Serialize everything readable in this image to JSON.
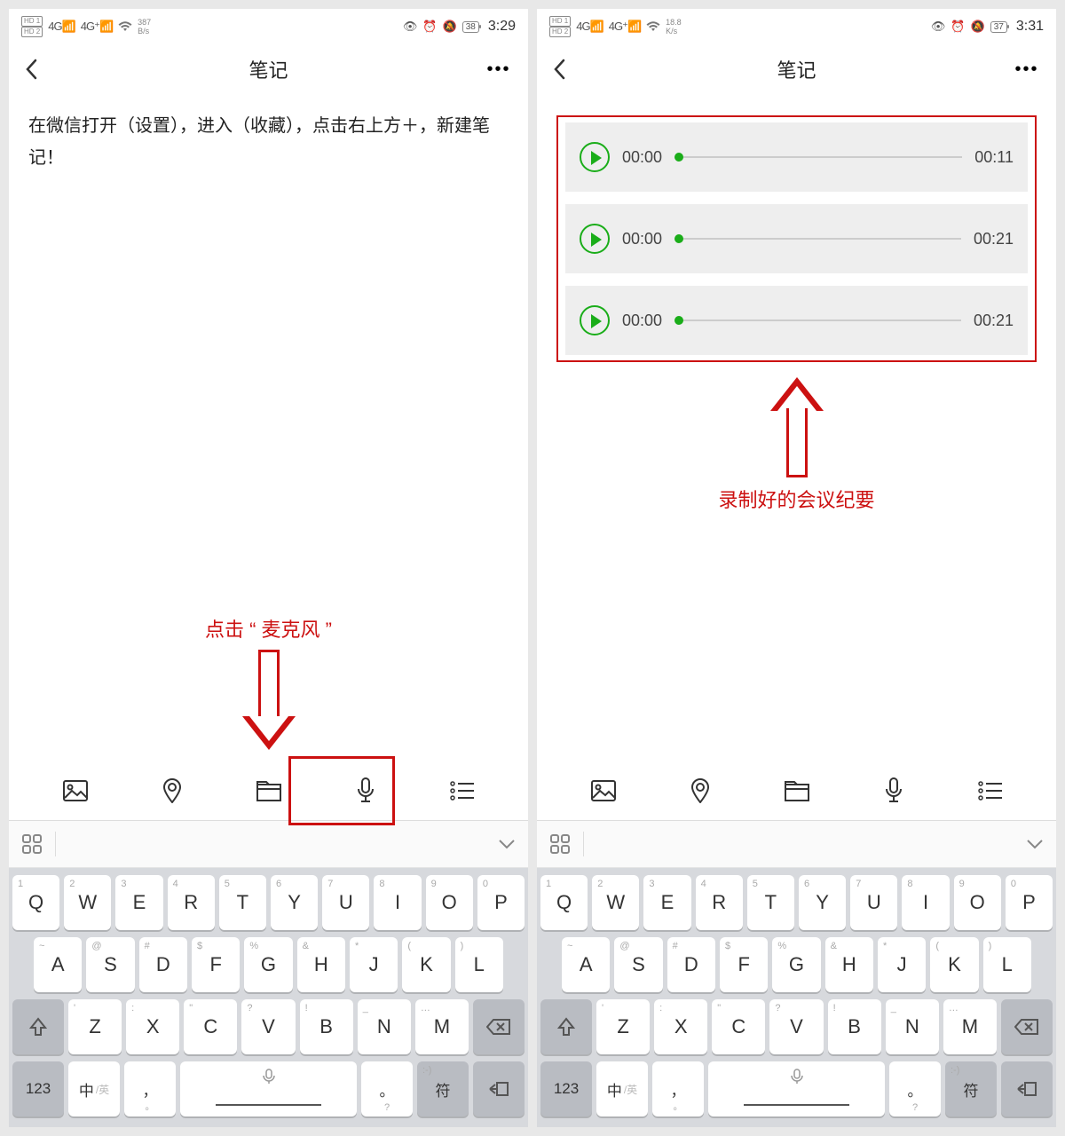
{
  "left": {
    "status": {
      "speed": "387",
      "speed_unit": "B/s",
      "battery": "38",
      "time": "3:29",
      "hd1": "HD 1",
      "hd2": "HD 2",
      "net1": "4G",
      "net2": "4G⁺"
    },
    "nav": {
      "title": "笔记"
    },
    "note_text": "在微信打开（设置），进入（收藏），点击右上方＋，新建笔记！",
    "annotation": "点击 “ 麦克风 ”"
  },
  "right": {
    "status": {
      "speed": "18.8",
      "speed_unit": "K/s",
      "battery": "37",
      "time": "3:31",
      "hd1": "HD 1",
      "hd2": "HD 2",
      "net1": "4G",
      "net2": "4G⁺"
    },
    "nav": {
      "title": "笔记"
    },
    "audio": [
      {
        "start": "00:00",
        "end": "00:11"
      },
      {
        "start": "00:00",
        "end": "00:21"
      },
      {
        "start": "00:00",
        "end": "00:21"
      }
    ],
    "annotation": "录制好的会议纪要"
  },
  "keyboard": {
    "row1": [
      {
        "k": "Q",
        "s": "1"
      },
      {
        "k": "W",
        "s": "2"
      },
      {
        "k": "E",
        "s": "3"
      },
      {
        "k": "R",
        "s": "4"
      },
      {
        "k": "T",
        "s": "5"
      },
      {
        "k": "Y",
        "s": "6"
      },
      {
        "k": "U",
        "s": "7"
      },
      {
        "k": "I",
        "s": "8"
      },
      {
        "k": "O",
        "s": "9"
      },
      {
        "k": "P",
        "s": "0"
      }
    ],
    "row2": [
      {
        "k": "A",
        "s": "~"
      },
      {
        "k": "S",
        "s": "@"
      },
      {
        "k": "D",
        "s": "#"
      },
      {
        "k": "F",
        "s": "$"
      },
      {
        "k": "G",
        "s": "%"
      },
      {
        "k": "H",
        "s": "&"
      },
      {
        "k": "J",
        "s": "*"
      },
      {
        "k": "K",
        "s": "("
      },
      {
        "k": "L",
        "s": ")"
      }
    ],
    "row3": [
      {
        "k": "Z",
        "s": "'"
      },
      {
        "k": "X",
        "s": ":"
      },
      {
        "k": "C",
        "s": "\""
      },
      {
        "k": "V",
        "s": "?"
      },
      {
        "k": "B",
        "s": "!"
      },
      {
        "k": "N",
        "s": "_"
      },
      {
        "k": "M",
        "s": "…"
      }
    ],
    "row4": {
      "num": "123",
      "lang_main": "中",
      "lang_sub": "/英",
      "comma": "，",
      "comma_sub": "。",
      "period": "。",
      "period_sub": "?",
      "sym": "符",
      "sym_sup": ":-)"
    }
  }
}
